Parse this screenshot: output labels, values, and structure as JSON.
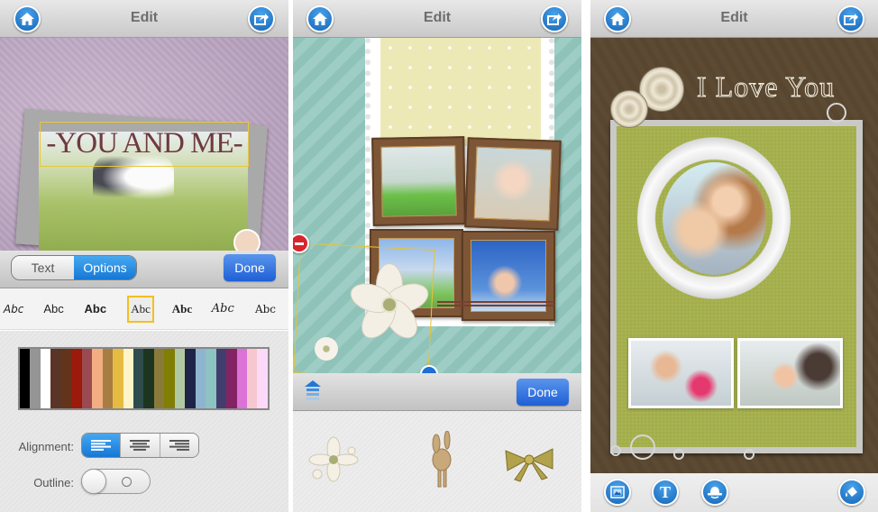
{
  "screens": [
    {
      "nav": {
        "title": "Edit",
        "home_icon": "home-icon",
        "share_icon": "share-icon"
      },
      "canvas": {
        "text_layer": "-YOU AND ME-"
      },
      "toolbar": {
        "segments": [
          {
            "label": "Text",
            "selected": false
          },
          {
            "label": "Options",
            "selected": true
          }
        ],
        "done_label": "Done"
      },
      "font_samples": [
        {
          "label": "Abc",
          "style": "script",
          "selected": false
        },
        {
          "label": "Abc",
          "style": "sans",
          "selected": false
        },
        {
          "label": "Abc",
          "style": "sans-bold",
          "selected": false
        },
        {
          "label": "Abc",
          "style": "serif",
          "selected": true
        },
        {
          "label": "Abc",
          "style": "serif-bold",
          "selected": false
        },
        {
          "label": "Abc",
          "style": "serif-italic",
          "selected": false
        },
        {
          "label": "Abc",
          "style": "serif-light",
          "selected": false
        }
      ],
      "palette": [
        "#000000",
        "#959595",
        "#ffffff",
        "#5a3527",
        "#62351b",
        "#9c1a0b",
        "#9c4a52",
        "#f2ae82",
        "#a87d42",
        "#e6bb42",
        "#fdf5c8",
        "#2f4c4c",
        "#1c3520",
        "#8a7a3a",
        "#817e05",
        "#b1c9a2",
        "#1e2448",
        "#8fb4d0",
        "#8dc3c0",
        "#413e6e",
        "#842364",
        "#da72d8",
        "#f7c7cf",
        "#fdd9f9"
      ],
      "alignment": {
        "label": "Alignment:",
        "options": [
          "left",
          "center",
          "right"
        ],
        "selected": "left"
      },
      "outline": {
        "label": "Outline:",
        "enabled": false
      }
    },
    {
      "nav": {
        "title": "Edit",
        "home_icon": "home-icon",
        "share_icon": "share-icon"
      },
      "toolbar": {
        "collapse_icon": "collapse-arrow-icon",
        "done_label": "Done"
      },
      "stickers": [
        {
          "name": "white-flower-sticker"
        },
        {
          "name": "dried-bouquet-sticker"
        },
        {
          "name": "gold-bow-sticker"
        }
      ]
    },
    {
      "nav": {
        "title": "Edit",
        "home_icon": "home-icon",
        "share_icon": "share-icon"
      },
      "canvas": {
        "title_text": "I Love You"
      },
      "toolbar": {
        "buttons": [
          {
            "name": "photos",
            "icon": "photo-frame-icon"
          },
          {
            "name": "text",
            "icon": "text-icon",
            "glyph": "T"
          },
          {
            "name": "sticker",
            "icon": "hat-sticker-icon"
          },
          {
            "name": "background",
            "icon": "paint-bucket-icon"
          }
        ]
      }
    }
  ]
}
